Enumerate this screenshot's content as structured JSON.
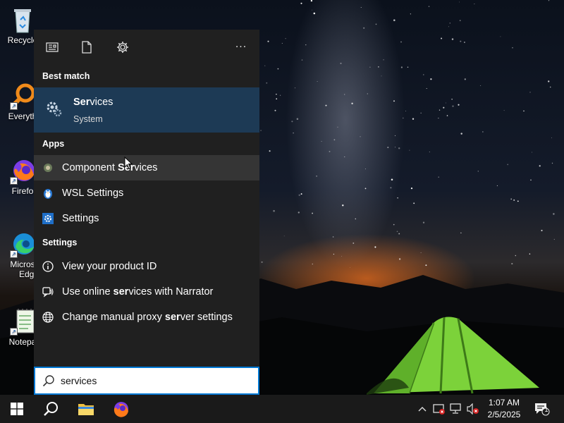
{
  "desktop": {
    "icons": [
      {
        "label": "Recycle",
        "icon": "recycle-bin-icon"
      },
      {
        "label": "Everyth",
        "icon": "everything-search-icon"
      },
      {
        "label": "Firefo",
        "icon": "firefox-icon"
      },
      {
        "label": "Micros",
        "label2": "Edge",
        "icon": "edge-icon"
      },
      {
        "label": "Notepa",
        "icon": "notepad-icon"
      }
    ]
  },
  "search_panel": {
    "toolbar_icons": [
      "news-icon",
      "document-icon",
      "gear-icon",
      "more-icon"
    ],
    "more_label": "···",
    "best_match": {
      "heading": "Best match",
      "title_bold": "Ser",
      "title_rest": "vices",
      "subtitle": "System",
      "icon": "services-gear-icon"
    },
    "apps": {
      "heading": "Apps",
      "items": [
        {
          "pre": "Component ",
          "bold": "Ser",
          "post": "vices",
          "icon": "component-services-icon"
        },
        {
          "pre": "WSL Settings",
          "bold": "",
          "post": "",
          "icon": "wsl-penguin-icon"
        },
        {
          "pre": "Settings",
          "bold": "",
          "post": "",
          "icon": "settings-gear-icon"
        }
      ]
    },
    "settings": {
      "heading": "Settings",
      "items": [
        {
          "pre": "View your product ID",
          "bold": "",
          "post": "",
          "icon": "info-icon"
        },
        {
          "pre": "Use online ",
          "bold": "ser",
          "post": "vices with Narrator",
          "icon": "narrator-icon"
        },
        {
          "pre": "Change manual proxy ",
          "bold": "ser",
          "post": "ver settings",
          "icon": "globe-icon"
        }
      ]
    }
  },
  "search": {
    "value": "services",
    "icon": "search-icon"
  },
  "taskbar": {
    "buttons": [
      "windows-start-icon",
      "search-icon",
      "file-explorer-icon",
      "firefox-icon"
    ],
    "tray": [
      "chevron-up-icon",
      "security-icon",
      "network-icon",
      "volume-muted-icon",
      "notifications-icon"
    ],
    "time": "1:07 AM",
    "date": "2/5/2025",
    "notification_count": "1"
  },
  "colors": {
    "panel_bg": "#202020",
    "best_match_bg": "#1d3a55",
    "hover_bg": "#353535",
    "accent": "#0078d4",
    "taskbar_bg": "#1a1a1a"
  }
}
